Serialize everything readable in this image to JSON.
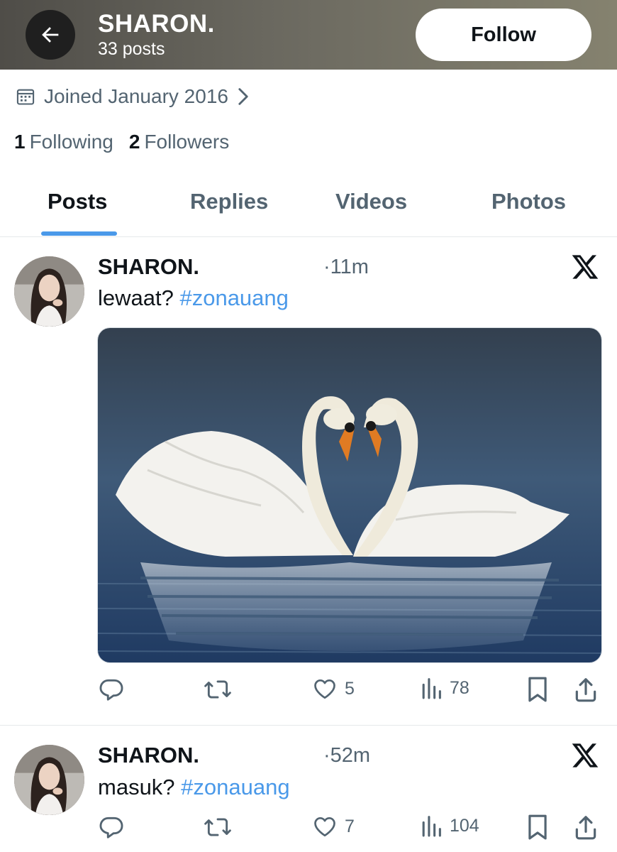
{
  "header": {
    "name": "SHARON.",
    "posts_count": "33 posts",
    "follow_label": "Follow"
  },
  "profile": {
    "joined": "Joined January 2016",
    "following_count": "1",
    "following_label": "Following",
    "followers_count": "2",
    "followers_label": "Followers"
  },
  "tabs": [
    {
      "label": "Posts",
      "active": true
    },
    {
      "label": "Replies",
      "active": false
    },
    {
      "label": "Videos",
      "active": false
    },
    {
      "label": "Photos",
      "active": false
    }
  ],
  "posts": [
    {
      "author": "SHARON.",
      "time": "·11m",
      "text": "lewaat? ",
      "hashtag": "#zonauang",
      "has_media": true,
      "replies": "",
      "reposts": "",
      "likes": "5",
      "views": "78"
    },
    {
      "author": "SHARON.",
      "time": "·52m",
      "text": "masuk? ",
      "hashtag": "#zonauang",
      "has_media": false,
      "replies": "",
      "reposts": "",
      "likes": "7",
      "views": "104"
    }
  ],
  "icons": {
    "back": "arrow-left-icon",
    "calendar": "calendar-icon",
    "chevron": "chevron-right-icon",
    "x_logo": "x-logo-icon",
    "reply": "reply-icon",
    "repost": "repost-icon",
    "like": "heart-icon",
    "views": "views-icon",
    "bookmark": "bookmark-icon",
    "share": "share-icon"
  },
  "colors": {
    "accent": "#4a99e9",
    "text_primary": "#0f1419",
    "text_secondary": "#536471"
  }
}
